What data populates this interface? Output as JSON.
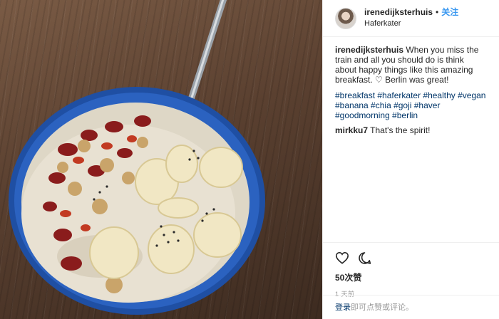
{
  "header": {
    "username": "irenedijksterhuis",
    "separator": "•",
    "follow_label": "关注",
    "location": "Haferkater"
  },
  "caption": {
    "username": "irenedijksterhuis",
    "text": "When you miss the train and all you should do is think about happy things like this amazing breakfast. ♡ Berlin was great!",
    "hashtags": "#breakfast #haferkater #healthy #vegan #banana #chia #goji #haver #goodmorning #berlin"
  },
  "comments": [
    {
      "username": "mirkku7",
      "text": "That's the spirit!"
    }
  ],
  "actions": {
    "like_icon": "heart-icon",
    "comment_icon": "speech-bubble-icon",
    "likes": "50次赞",
    "time": "1 天前"
  },
  "login_bar": {
    "link": "登录",
    "text": "即可点赞或评论。"
  },
  "colors": {
    "link": "#3897f0",
    "hashtag": "#003569",
    "muted": "#999999",
    "divider": "#efefef"
  }
}
